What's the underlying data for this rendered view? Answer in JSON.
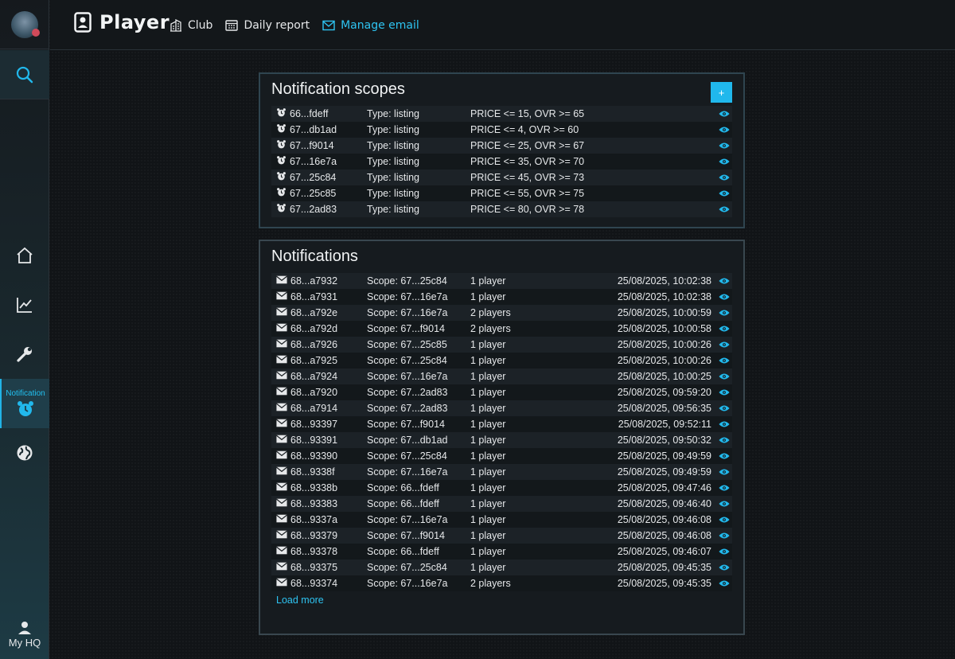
{
  "header": {
    "title": "Player",
    "nav": [
      {
        "label": "Club",
        "icon": "building-icon",
        "active": false
      },
      {
        "label": "Daily report",
        "icon": "calendar-icon",
        "active": false
      },
      {
        "label": "Manage email",
        "icon": "email-icon",
        "active": true
      }
    ]
  },
  "sidebar": {
    "items": [
      {
        "name": "home",
        "icon": "home-icon"
      },
      {
        "name": "stats",
        "icon": "chart-icon"
      },
      {
        "name": "tools",
        "icon": "wrench-icon"
      },
      {
        "name": "notification",
        "label": "Notification",
        "icon": "alarm-clock-icon",
        "active": true
      },
      {
        "name": "globe",
        "icon": "globe-icon"
      }
    ],
    "my_hq_label": "My HQ"
  },
  "scopes": {
    "title": "Notification scopes",
    "add_label": "+",
    "rows": [
      {
        "id": "66...fdeff",
        "type": "Type: listing",
        "rule": "PRICE <= 15, OVR >= 65"
      },
      {
        "id": "67...db1ad",
        "type": "Type: listing",
        "rule": "PRICE <= 4, OVR >= 60"
      },
      {
        "id": "67...f9014",
        "type": "Type: listing",
        "rule": "PRICE <= 25, OVR >= 67"
      },
      {
        "id": "67...16e7a",
        "type": "Type: listing",
        "rule": "PRICE <= 35, OVR >= 70"
      },
      {
        "id": "67...25c84",
        "type": "Type: listing",
        "rule": "PRICE <= 45, OVR >= 73"
      },
      {
        "id": "67...25c85",
        "type": "Type: listing",
        "rule": "PRICE <= 55, OVR >= 75"
      },
      {
        "id": "67...2ad83",
        "type": "Type: listing",
        "rule": "PRICE <= 80, OVR >= 78"
      }
    ]
  },
  "notifications": {
    "title": "Notifications",
    "load_more": "Load more",
    "rows": [
      {
        "id": "68...a7932",
        "scope": "Scope: 67...25c84",
        "count": "1 player",
        "date": "25/08/2025, 10:02:38"
      },
      {
        "id": "68...a7931",
        "scope": "Scope: 67...16e7a",
        "count": "1 player",
        "date": "25/08/2025, 10:02:38"
      },
      {
        "id": "68...a792e",
        "scope": "Scope: 67...16e7a",
        "count": "2 players",
        "date": "25/08/2025, 10:00:59"
      },
      {
        "id": "68...a792d",
        "scope": "Scope: 67...f9014",
        "count": "2 players",
        "date": "25/08/2025, 10:00:58"
      },
      {
        "id": "68...a7926",
        "scope": "Scope: 67...25c85",
        "count": "1 player",
        "date": "25/08/2025, 10:00:26"
      },
      {
        "id": "68...a7925",
        "scope": "Scope: 67...25c84",
        "count": "1 player",
        "date": "25/08/2025, 10:00:26"
      },
      {
        "id": "68...a7924",
        "scope": "Scope: 67...16e7a",
        "count": "1 player",
        "date": "25/08/2025, 10:00:25"
      },
      {
        "id": "68...a7920",
        "scope": "Scope: 67...2ad83",
        "count": "1 player",
        "date": "25/08/2025, 09:59:20"
      },
      {
        "id": "68...a7914",
        "scope": "Scope: 67...2ad83",
        "count": "1 player",
        "date": "25/08/2025, 09:56:35"
      },
      {
        "id": "68...93397",
        "scope": "Scope: 67...f9014",
        "count": "1 player",
        "date": "25/08/2025, 09:52:11"
      },
      {
        "id": "68...93391",
        "scope": "Scope: 67...db1ad",
        "count": "1 player",
        "date": "25/08/2025, 09:50:32"
      },
      {
        "id": "68...93390",
        "scope": "Scope: 67...25c84",
        "count": "1 player",
        "date": "25/08/2025, 09:49:59"
      },
      {
        "id": "68...9338f",
        "scope": "Scope: 67...16e7a",
        "count": "1 player",
        "date": "25/08/2025, 09:49:59"
      },
      {
        "id": "68...9338b",
        "scope": "Scope: 66...fdeff",
        "count": "1 player",
        "date": "25/08/2025, 09:47:46"
      },
      {
        "id": "68...93383",
        "scope": "Scope: 66...fdeff",
        "count": "1 player",
        "date": "25/08/2025, 09:46:40"
      },
      {
        "id": "68...9337a",
        "scope": "Scope: 67...16e7a",
        "count": "1 player",
        "date": "25/08/2025, 09:46:08"
      },
      {
        "id": "68...93379",
        "scope": "Scope: 67...f9014",
        "count": "1 player",
        "date": "25/08/2025, 09:46:08"
      },
      {
        "id": "68...93378",
        "scope": "Scope: 66...fdeff",
        "count": "1 player",
        "date": "25/08/2025, 09:46:07"
      },
      {
        "id": "68...93375",
        "scope": "Scope: 67...25c84",
        "count": "1 player",
        "date": "25/08/2025, 09:45:35"
      },
      {
        "id": "68...93374",
        "scope": "Scope: 67...16e7a",
        "count": "2 players",
        "date": "25/08/2025, 09:45:35"
      }
    ]
  },
  "colors": {
    "accent": "#21b8ec",
    "background": "#111417",
    "panel": "#161b1f"
  }
}
